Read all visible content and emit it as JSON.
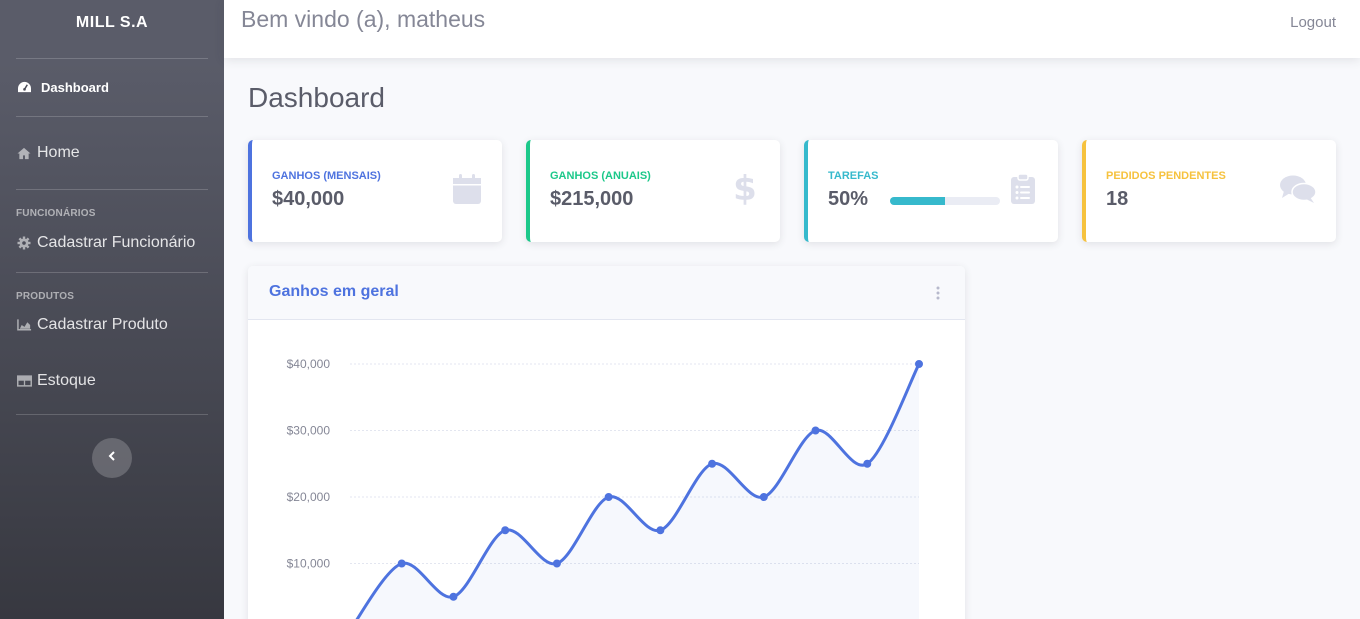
{
  "sidebar": {
    "brand": "MILL S.A",
    "dashboard": "Dashboard",
    "home": "Home",
    "heading_funcionarios": "FUNCIONÁRIOS",
    "cadastrar_funcionario": "Cadastrar Funcionário",
    "heading_produtos": "PRODUTOS",
    "cadastrar_produto": "Cadastrar Produto",
    "estoque": "Estoque",
    "toggle_icon": "chevron-left-icon"
  },
  "topbar": {
    "welcome": "Bem vindo (a), matheus",
    "logout": "Logout"
  },
  "page_title": "Dashboard",
  "cards": [
    {
      "label": "GANHOS (MENSAIS)",
      "value": "$40,000",
      "color": "#4e73df",
      "icon": "calendar-icon"
    },
    {
      "label": "GANHOS (ANUAIS)",
      "value": "$215,000",
      "color": "#1cc88a",
      "icon": "dollar-icon"
    },
    {
      "label": "TAREFAS",
      "value": "50%",
      "color": "#36b9cc",
      "icon": "clipboard-list-icon",
      "progress": 0.5
    },
    {
      "label": "PEDIDOS PENDENTES",
      "value": "18",
      "color": "#f6c23e",
      "icon": "comments-icon"
    }
  ],
  "chart_card": {
    "title": "Ganhos em geral",
    "menu_icon": "ellipsis-vertical-icon"
  },
  "chart_data": {
    "type": "area",
    "title": "Ganhos em geral",
    "y_ticks": [
      "$10,000",
      "$20,000",
      "$30,000",
      "$40,000"
    ],
    "y_tick_values": [
      10000,
      20000,
      30000,
      40000
    ],
    "ylim": [
      0,
      40000
    ],
    "series": [
      {
        "values": [
          0,
          10000,
          5000,
          15000,
          10000,
          20000,
          15000,
          25000,
          20000,
          30000,
          25000,
          40000
        ]
      }
    ],
    "color": "#4e73df",
    "grid": true
  }
}
